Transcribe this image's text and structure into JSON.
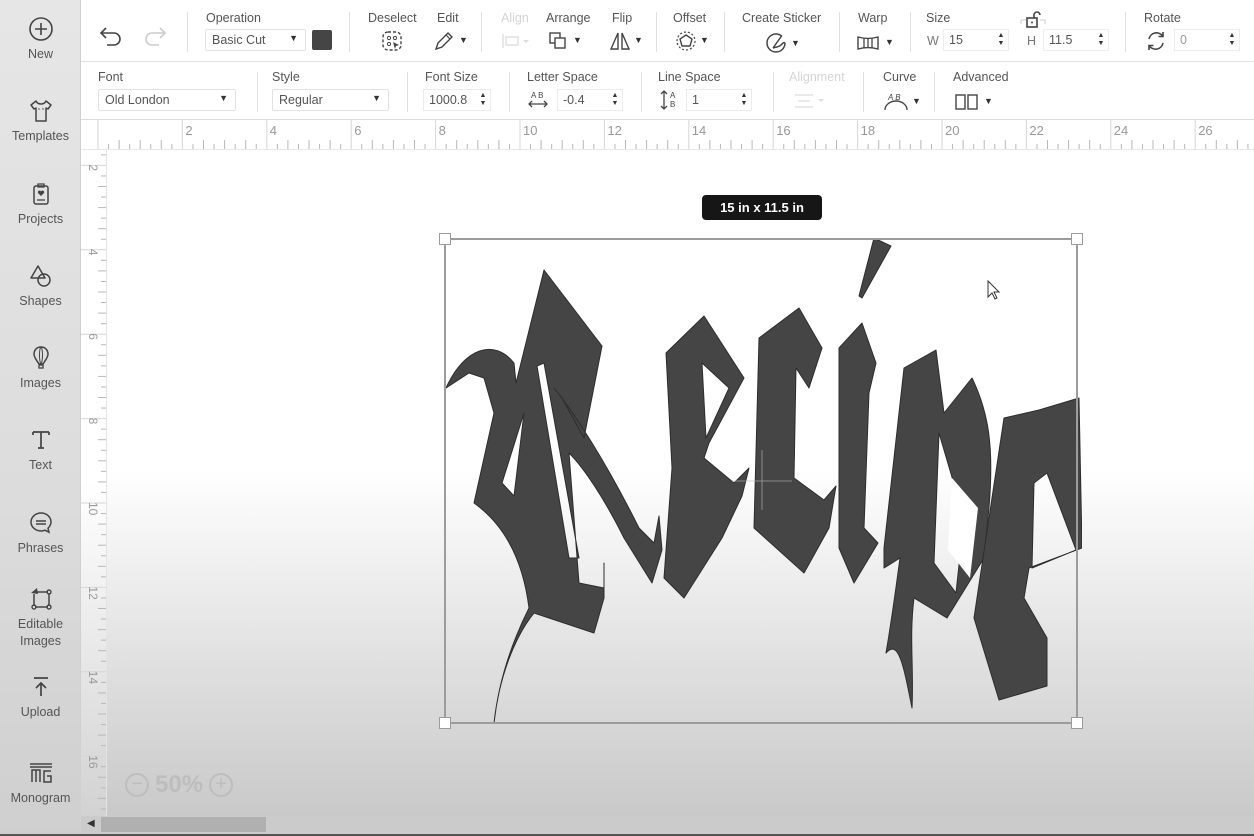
{
  "sidebar": {
    "items": [
      {
        "label": "New",
        "icon": "plus-circle-icon"
      },
      {
        "label": "Templates",
        "icon": "shirt-icon"
      },
      {
        "label": "Projects",
        "icon": "projects-icon"
      },
      {
        "label": "Shapes",
        "icon": "shapes-icon"
      },
      {
        "label": "Images",
        "icon": "balloon-icon"
      },
      {
        "label": "Text",
        "icon": "text-icon"
      },
      {
        "label": "Phrases",
        "icon": "speech-bubble-icon"
      },
      {
        "label": "Editable Images",
        "icon": "editable-images-icon"
      },
      {
        "label": "Upload",
        "icon": "upload-icon"
      },
      {
        "label": "Monogram",
        "icon": "monogram-icon"
      }
    ]
  },
  "toolbar": {
    "operation_label": "Operation",
    "operation_value": "Basic Cut",
    "operation_color": "#454545",
    "deselect_label": "Deselect",
    "edit_label": "Edit",
    "align_label": "Align",
    "arrange_label": "Arrange",
    "flip_label": "Flip",
    "offset_label": "Offset",
    "create_sticker_label": "Create Sticker",
    "warp_label": "Warp",
    "size_label": "Size",
    "width_prefix": "W",
    "width_value": "15",
    "height_prefix": "H",
    "height_value": "11.5",
    "rotate_label": "Rotate",
    "rotate_value": "0"
  },
  "text_toolbar": {
    "font_label": "Font",
    "font_value": "Old London",
    "style_label": "Style",
    "style_value": "Regular",
    "font_size_label": "Font Size",
    "font_size_value": "1000.8",
    "letter_space_label": "Letter Space",
    "letter_space_value": "-0.4",
    "line_space_label": "Line Space",
    "line_space_value": "1",
    "alignment_label": "Alignment",
    "curve_label": "Curve",
    "advanced_label": "Advanced"
  },
  "ruler": {
    "top": [
      "2",
      "4",
      "6",
      "8",
      "10",
      "12",
      "14",
      "16",
      "18",
      "20",
      "22",
      "24",
      "26"
    ],
    "left": [
      "2",
      "4",
      "6",
      "8",
      "10",
      "12",
      "14",
      "16"
    ]
  },
  "canvas": {
    "size_badge": "15  in x 11.5  in",
    "text_content": "Recipe",
    "text_color": "#454545",
    "zoom_value": "50%"
  }
}
